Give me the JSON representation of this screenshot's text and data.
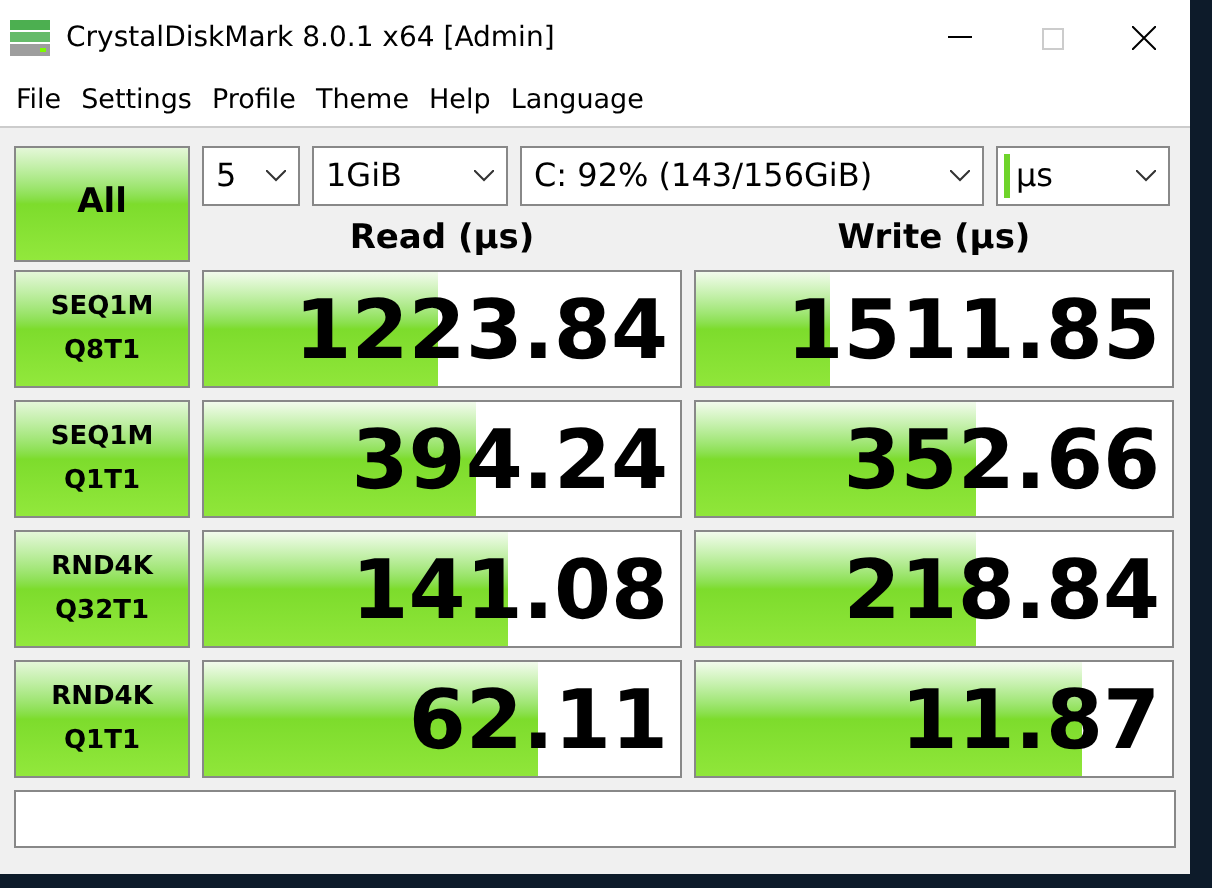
{
  "window": {
    "title": "CrystalDiskMark 8.0.1 x64 [Admin]"
  },
  "menu": [
    "File",
    "Settings",
    "Profile",
    "Theme",
    "Help",
    "Language"
  ],
  "all_button": "All",
  "selectors": [
    {
      "value": "5",
      "kind": "plain"
    },
    {
      "value": "1GiB",
      "kind": "plain"
    },
    {
      "value": "C: 92% (143/156GiB)",
      "kind": "plain"
    },
    {
      "value": "µs",
      "kind": "unit"
    }
  ],
  "columns": [
    "Read (µs)",
    "Write (µs)"
  ],
  "tests": [
    {
      "label": "SEQ1M",
      "sub": "Q8T1",
      "read": {
        "value": "1223.84",
        "level": 0.49
      },
      "write": {
        "value": "1511.85",
        "level": 0.28
      }
    },
    {
      "label": "SEQ1M",
      "sub": "Q1T1",
      "read": {
        "value": "394.24",
        "level": 0.57
      },
      "write": {
        "value": "352.66",
        "level": 0.59
      }
    },
    {
      "label": "RND4K",
      "sub": "Q32T1",
      "read": {
        "value": "141.08",
        "level": 0.64
      },
      "write": {
        "value": "218.84",
        "level": 0.59
      }
    },
    {
      "label": "RND4K",
      "sub": "Q1T1",
      "read": {
        "value": "62.11",
        "level": 0.7
      },
      "write": {
        "value": "11.87",
        "level": 0.81
      }
    }
  ]
}
